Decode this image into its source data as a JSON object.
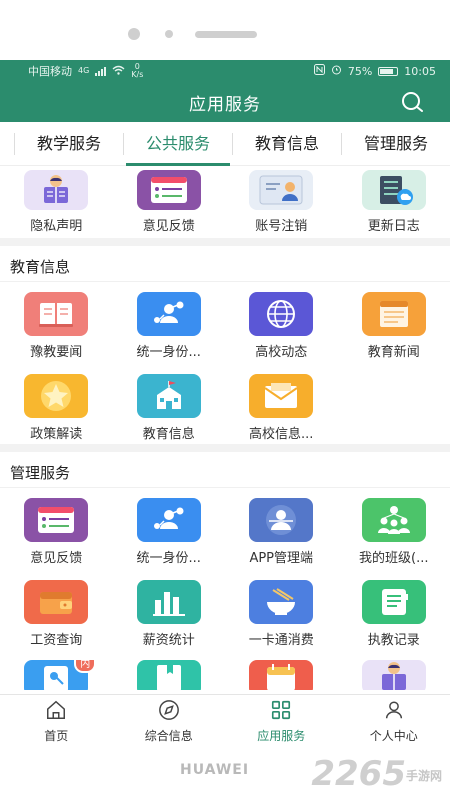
{
  "status": {
    "carrier": "中国移动",
    "net_type": "4G",
    "speed_value": "0",
    "speed_unit": "K/s",
    "battery": "75%",
    "time": "10:05"
  },
  "appbar": {
    "title": "应用服务",
    "search_icon": "search-icon"
  },
  "tabs": [
    {
      "label": "教学服务"
    },
    {
      "label": "公共服务",
      "active": true
    },
    {
      "label": "教育信息"
    },
    {
      "label": "管理服务"
    }
  ],
  "top_row": [
    {
      "label": "隐私声明",
      "icon": "reader-icon",
      "bg": "#e9e2f7"
    },
    {
      "label": "意见反馈",
      "icon": "feedback-list-icon",
      "bg": "#8a52a6"
    },
    {
      "label": "账号注销",
      "icon": "account-card-icon",
      "bg": "#e8eef6"
    },
    {
      "label": "更新日志",
      "icon": "server-cloud-icon",
      "bg": "#d7efe6"
    }
  ],
  "edu_section": {
    "title": "教育信息",
    "items": [
      {
        "label": "豫教要闻",
        "icon": "open-book-icon",
        "bg": "#f07f79"
      },
      {
        "label": "统一身份...",
        "icon": "identity-share-icon",
        "bg": "#3a8ef0"
      },
      {
        "label": "高校动态",
        "icon": "globe-icon",
        "bg": "#5b57d6"
      },
      {
        "label": "教育新闻",
        "icon": "newspaper-icon",
        "bg": "#f6a13a"
      },
      {
        "label": "政策解读",
        "icon": "star-icon",
        "bg": "#f8b72f"
      },
      {
        "label": "教育信息",
        "icon": "school-building-icon",
        "bg": "#3bb4cf"
      },
      {
        "label": "高校信息...",
        "icon": "envelope-icon",
        "bg": "#f7ae2c"
      }
    ]
  },
  "mgmt_section": {
    "title": "管理服务",
    "items": [
      {
        "label": "意见反馈",
        "icon": "feedback-list-icon",
        "bg": "#8a52a6"
      },
      {
        "label": "统一身份...",
        "icon": "identity-share-icon",
        "bg": "#3a8ef0"
      },
      {
        "label": "APP管理端",
        "icon": "admin-user-icon",
        "bg": "#5477c9"
      },
      {
        "label": "我的班级(...",
        "icon": "class-group-icon",
        "bg": "#4cc46a"
      },
      {
        "label": "工资查询",
        "icon": "wallet-icon",
        "bg": "#f06a4a"
      },
      {
        "label": "薪资统计",
        "icon": "bar-stats-icon",
        "bg": "#2fb3a1"
      },
      {
        "label": "一卡通消费",
        "icon": "bowl-icon",
        "bg": "#4d7fe0"
      },
      {
        "label": "执教记录",
        "icon": "notebook-icon",
        "bg": "#37c07a"
      },
      {
        "label": "",
        "icon": "key-doc-icon",
        "bg": "#3a9ef0",
        "badge": "内"
      },
      {
        "label": "",
        "icon": "bookmark-book-icon",
        "bg": "#2fc3a8"
      },
      {
        "label": "",
        "icon": "calendar-icon",
        "bg": "#ef5e4c"
      },
      {
        "label": "",
        "icon": "reader-icon",
        "bg": "#e9e2f7"
      }
    ]
  },
  "bottom_nav": [
    {
      "label": "首页",
      "icon": "home-icon"
    },
    {
      "label": "综合信息",
      "icon": "compass-icon"
    },
    {
      "label": "应用服务",
      "icon": "grid-apps-icon",
      "active": true
    },
    {
      "label": "个人中心",
      "icon": "person-icon"
    }
  ],
  "footer": {
    "brand": "HUAWEI",
    "watermark": "2265",
    "watermark_sub": "手游网"
  },
  "colors": {
    "primary": "#2b8c6d",
    "text": "#222222",
    "divider": "#f2f2f2"
  }
}
